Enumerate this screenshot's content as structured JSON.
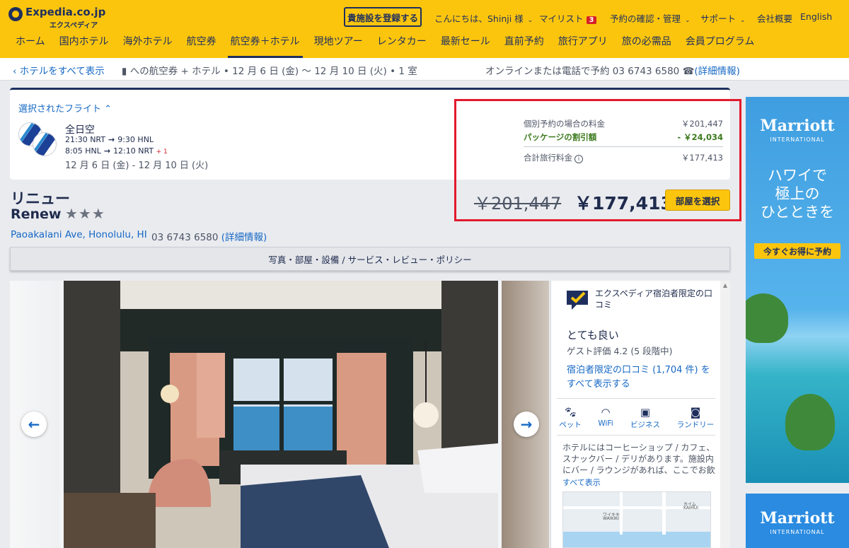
{
  "header": {
    "logo_text": "Expedia.co.jp",
    "logo_sub": "エクスペディア",
    "register_button": "貴施設を登録する",
    "greeting": "こんにちは、Shinji 様",
    "mylist_label": "マイリスト",
    "mylist_count": "3",
    "reservations": "予約の確認・管理",
    "support": "サポート",
    "company": "会社概要",
    "language": "English"
  },
  "mainnav": {
    "items": [
      "ホーム",
      "国内ホテル",
      "海外ホテル",
      "航空券",
      "航空券＋ホテル",
      "現地ツアー",
      "レンタカー",
      "最新セール",
      "直前予約",
      "旅行アプリ",
      "旅の必需品",
      "会員プログラム"
    ]
  },
  "subbar": {
    "back_link": "ホテルをすべて表示",
    "trip_summary": "への航空券 + ホテル • 12 月 6 日 (金) ～ 12 月 10 日 (火) • 1 室",
    "contact_text": "オンラインまたは電話で予約 03 6743 6580",
    "contact_link": "(詳細情報)"
  },
  "flight": {
    "title": "選択されたフライト",
    "airline": "全日空",
    "outbound_depart": "21:30",
    "outbound_from": "NRT",
    "outbound_arrive": "9:30",
    "outbound_to": "HNL",
    "return_depart": "8:05",
    "return_from": "HNL",
    "return_arrive": "12:10",
    "return_to": "NRT",
    "return_day_offset": "+ 1",
    "dates": "12 月 6 日 (金) - 12 月 10 日 (火)"
  },
  "pricing": {
    "separate_label": "個別予約の場合の料金",
    "separate_value": "￥201,447",
    "discount_label": "パッケージの割引額",
    "discount_value": "- ￥24,034",
    "total_label": "合計旅行料金",
    "total_value": "￥177,413",
    "strike_price": "￥201,447",
    "final_price": "￥177,413",
    "select_button": "部屋を選択"
  },
  "hotel": {
    "name_ja": "リニュー",
    "name_en": "Renew",
    "stars": "★★★",
    "address": "Paoakalani Ave,  Honolulu,  HI",
    "phone": "03 6743 6580",
    "phone_link": "(詳細情報)",
    "tabs": "写真・部屋・設備 / サービス・レビュー・ポリシー"
  },
  "review": {
    "label": "エクスペディア宿泊者限定の口コミ",
    "rating_word": "とても良い",
    "rating_score": "ゲスト評価 4.2 (5 段階中)",
    "reviews_link": "宿泊者限定の口コミ (1,704 件) をすべて表示する",
    "amenities": [
      {
        "icon": "paw-icon",
        "label": "ペット"
      },
      {
        "icon": "wifi-icon",
        "label": "WiFi"
      },
      {
        "icon": "briefcase-icon",
        "label": "ビジネス"
      },
      {
        "icon": "laundry-icon",
        "label": "ランドリー"
      }
    ],
    "description": "ホテルにはコーヒーショップ / カフェ、スナックバー / デリがあります。施設内にバー / ラウンジがあれば、ここでお飲み",
    "see_all": "すべて表示",
    "map_labels": [
      "ワイキキ",
      "WAIKIKI",
      "カイム",
      "KAIMUI"
    ]
  },
  "ad": {
    "brand": "Marriott",
    "brand_sub": "INTERNATIONAL",
    "headline_1": "ハワイで",
    "headline_2": "極上の",
    "headline_3": "ひとときを",
    "cta": "今すぐお得に予約"
  },
  "colors": {
    "header_yellow": "#fcc50d",
    "brand_navy": "#1e2f5e",
    "link_blue": "#1668c5",
    "discount_green": "#3c7a1e",
    "highlight_red": "#e21a2c"
  }
}
